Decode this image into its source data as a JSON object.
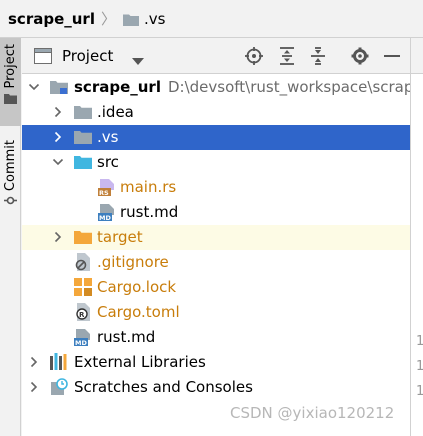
{
  "breadcrumb": {
    "root": "scrape_url",
    "separator": "〉",
    "leaf": ".vs"
  },
  "left_strip": {
    "project_tab": "Project",
    "commit_tab": "Commit"
  },
  "panel": {
    "title": "Project"
  },
  "tree": {
    "root": {
      "name": "scrape_url",
      "path": "D:\\devsoft\\rust_workspace\\scrape_"
    },
    "idea": ".idea",
    "vs": ".vs",
    "src": "src",
    "main_rs": "main.rs",
    "src_rust_md": "rust.md",
    "target": "target",
    "gitignore": ".gitignore",
    "cargo_lock": "Cargo.lock",
    "cargo_toml": "Cargo.toml",
    "rust_md": "rust.md",
    "external_libraries": "External Libraries",
    "scratches": "Scratches and Consoles"
  },
  "gutter": [
    "1",
    "1",
    "1"
  ],
  "watermark": "CSDN @yixiao120212",
  "colors": {
    "selection": "#2f65ca",
    "folder_gray": "#9aa7b0",
    "folder_blue": "#40b6e0",
    "folder_orange": "#f4a73b",
    "target_highlight": "#fdfbe5"
  }
}
